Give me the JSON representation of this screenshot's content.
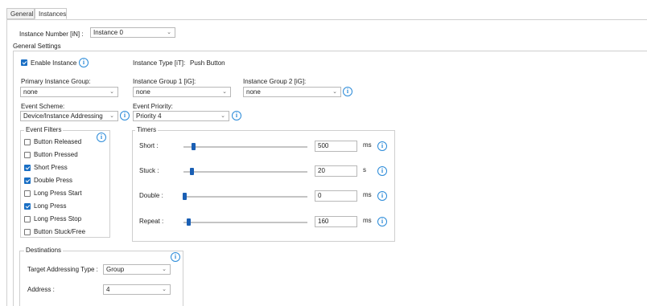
{
  "tabs": {
    "general": "General",
    "instances": "Instances"
  },
  "instance_number": {
    "label": "Instance Number [iN] :",
    "value": "Instance 0"
  },
  "general_settings": {
    "title": "General Settings"
  },
  "enable_instance": {
    "label": "Enable Instance",
    "checked": true
  },
  "instance_type": {
    "label": "Instance Type [iT]:",
    "value": "Push Button"
  },
  "primary_group": {
    "label": "Primary Instance Group:",
    "value": "none"
  },
  "group1": {
    "label": "Instance Group 1 [iG]:",
    "value": "none"
  },
  "group2": {
    "label": "Instance Group 2 [iG]:",
    "value": "none"
  },
  "event_scheme": {
    "label": "Event Scheme:",
    "value": "Device/Instance Addressing"
  },
  "event_priority": {
    "label": "Event Priority:",
    "value": "Priority 4"
  },
  "event_filters": {
    "title": "Event Filters",
    "items": [
      {
        "label": "Button Released",
        "checked": false
      },
      {
        "label": "Button Pressed",
        "checked": false
      },
      {
        "label": "Short Press",
        "checked": true
      },
      {
        "label": "Double Press",
        "checked": true
      },
      {
        "label": "Long Press Start",
        "checked": false
      },
      {
        "label": "Long Press",
        "checked": true
      },
      {
        "label": "Long Press Stop",
        "checked": false
      },
      {
        "label": "Button Stuck/Free",
        "checked": false
      }
    ]
  },
  "timers": {
    "title": "Timers",
    "rows": [
      {
        "label": "Short :",
        "value": "500",
        "unit": "ms",
        "level": 0.07
      },
      {
        "label": "Stuck :",
        "value": "20",
        "unit": "s",
        "level": 0.06
      },
      {
        "label": "Double :",
        "value": "0",
        "unit": "ms",
        "level": 0.0
      },
      {
        "label": "Repeat :",
        "value": "160",
        "unit": "ms",
        "level": 0.03
      }
    ]
  },
  "destinations": {
    "title": "Destinations",
    "target_type": {
      "label": "Target Addressing Type :",
      "value": "Group"
    },
    "address": {
      "label": "Address :",
      "value": "4"
    }
  },
  "icons": {
    "info": "info-icon",
    "chevron": "chevron-down-icon",
    "checkbox": "checkbox-icon"
  },
  "colors": {
    "accent": "#1a6fc4",
    "info": "#2a8ad8",
    "slider_thumb": "#1a5fb4"
  }
}
